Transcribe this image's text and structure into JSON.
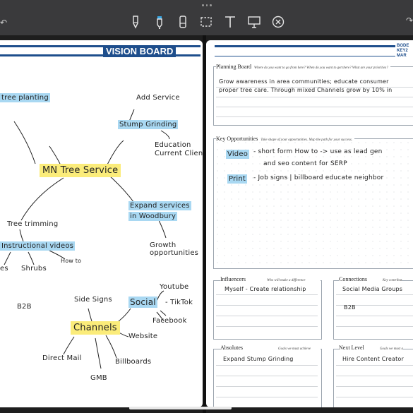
{
  "toolbar": {
    "tools": [
      "pen-icon",
      "marker-icon",
      "eraser-icon",
      "lasso-icon",
      "text-icon",
      "whiteboard-icon",
      "close-circle-icon"
    ]
  },
  "left_page": {
    "title": "VISION BOARD",
    "center": "MN Tree Service",
    "nodes": {
      "tree_planting": "tree planting",
      "add_service": "Add Service",
      "stump_grinding": "Stump Grinding",
      "education": "Education",
      "current_clients": "Current Clients",
      "expand_services": "Expand services",
      "in_woodbury": "in Woodbury",
      "growth": "Growth",
      "opportunities": "opportunities",
      "tree_trimming": "Tree trimming",
      "instructional_videos": "Instructional videos",
      "es": "es",
      "shrubs": "Shrubs",
      "how_to": "How to",
      "b2b": "B2B",
      "side_signs": "Side Signs",
      "channels": "Channels",
      "social": "Social",
      "youtube": "Youtube",
      "tiktok": "- TikTok",
      "facebook": "Facebook",
      "website": "Website",
      "direct_mail": "Direct Mail",
      "billboards": "Billboards",
      "gmb": "GMB"
    }
  },
  "right_page": {
    "brand": [
      "BODE",
      "KEY2",
      "MAR"
    ],
    "planning": {
      "title": "Planning Board",
      "subtitle": "Where do you want to go from here? When do you want to get there? What are your priorities?",
      "line1": "Grow awareness in area communities; educate consumer",
      "line2": "proper tree care. Through mixed Channels grow by 10% in"
    },
    "opportunities": {
      "title": "Key Opportunities",
      "subtitle": "Take shape of your opportunities. Map the path for your success.",
      "video_tag": "Video",
      "video_text1": "- short form How to -> use as lead gen",
      "video_text2": "and seo content for SERP",
      "print_tag": "Print",
      "print_text": "- Job signs | billboard educate neighbor"
    },
    "influencers": {
      "title": "Influencers",
      "subtitle": "Who will make a difference",
      "entry": "Myself - Create relationship"
    },
    "connections": {
      "title": "Connections",
      "subtitle": "Key contribut",
      "entry1": "Social Media Groups",
      "entry2": "B2B"
    },
    "absolutes": {
      "title": "Absolutes",
      "subtitle": "Goals we must achieve",
      "entry": "Expand Stump Grinding"
    },
    "next_level": {
      "title": "Next Level",
      "subtitle": "Goals we must a",
      "entry": "Hire Content Creator"
    }
  }
}
